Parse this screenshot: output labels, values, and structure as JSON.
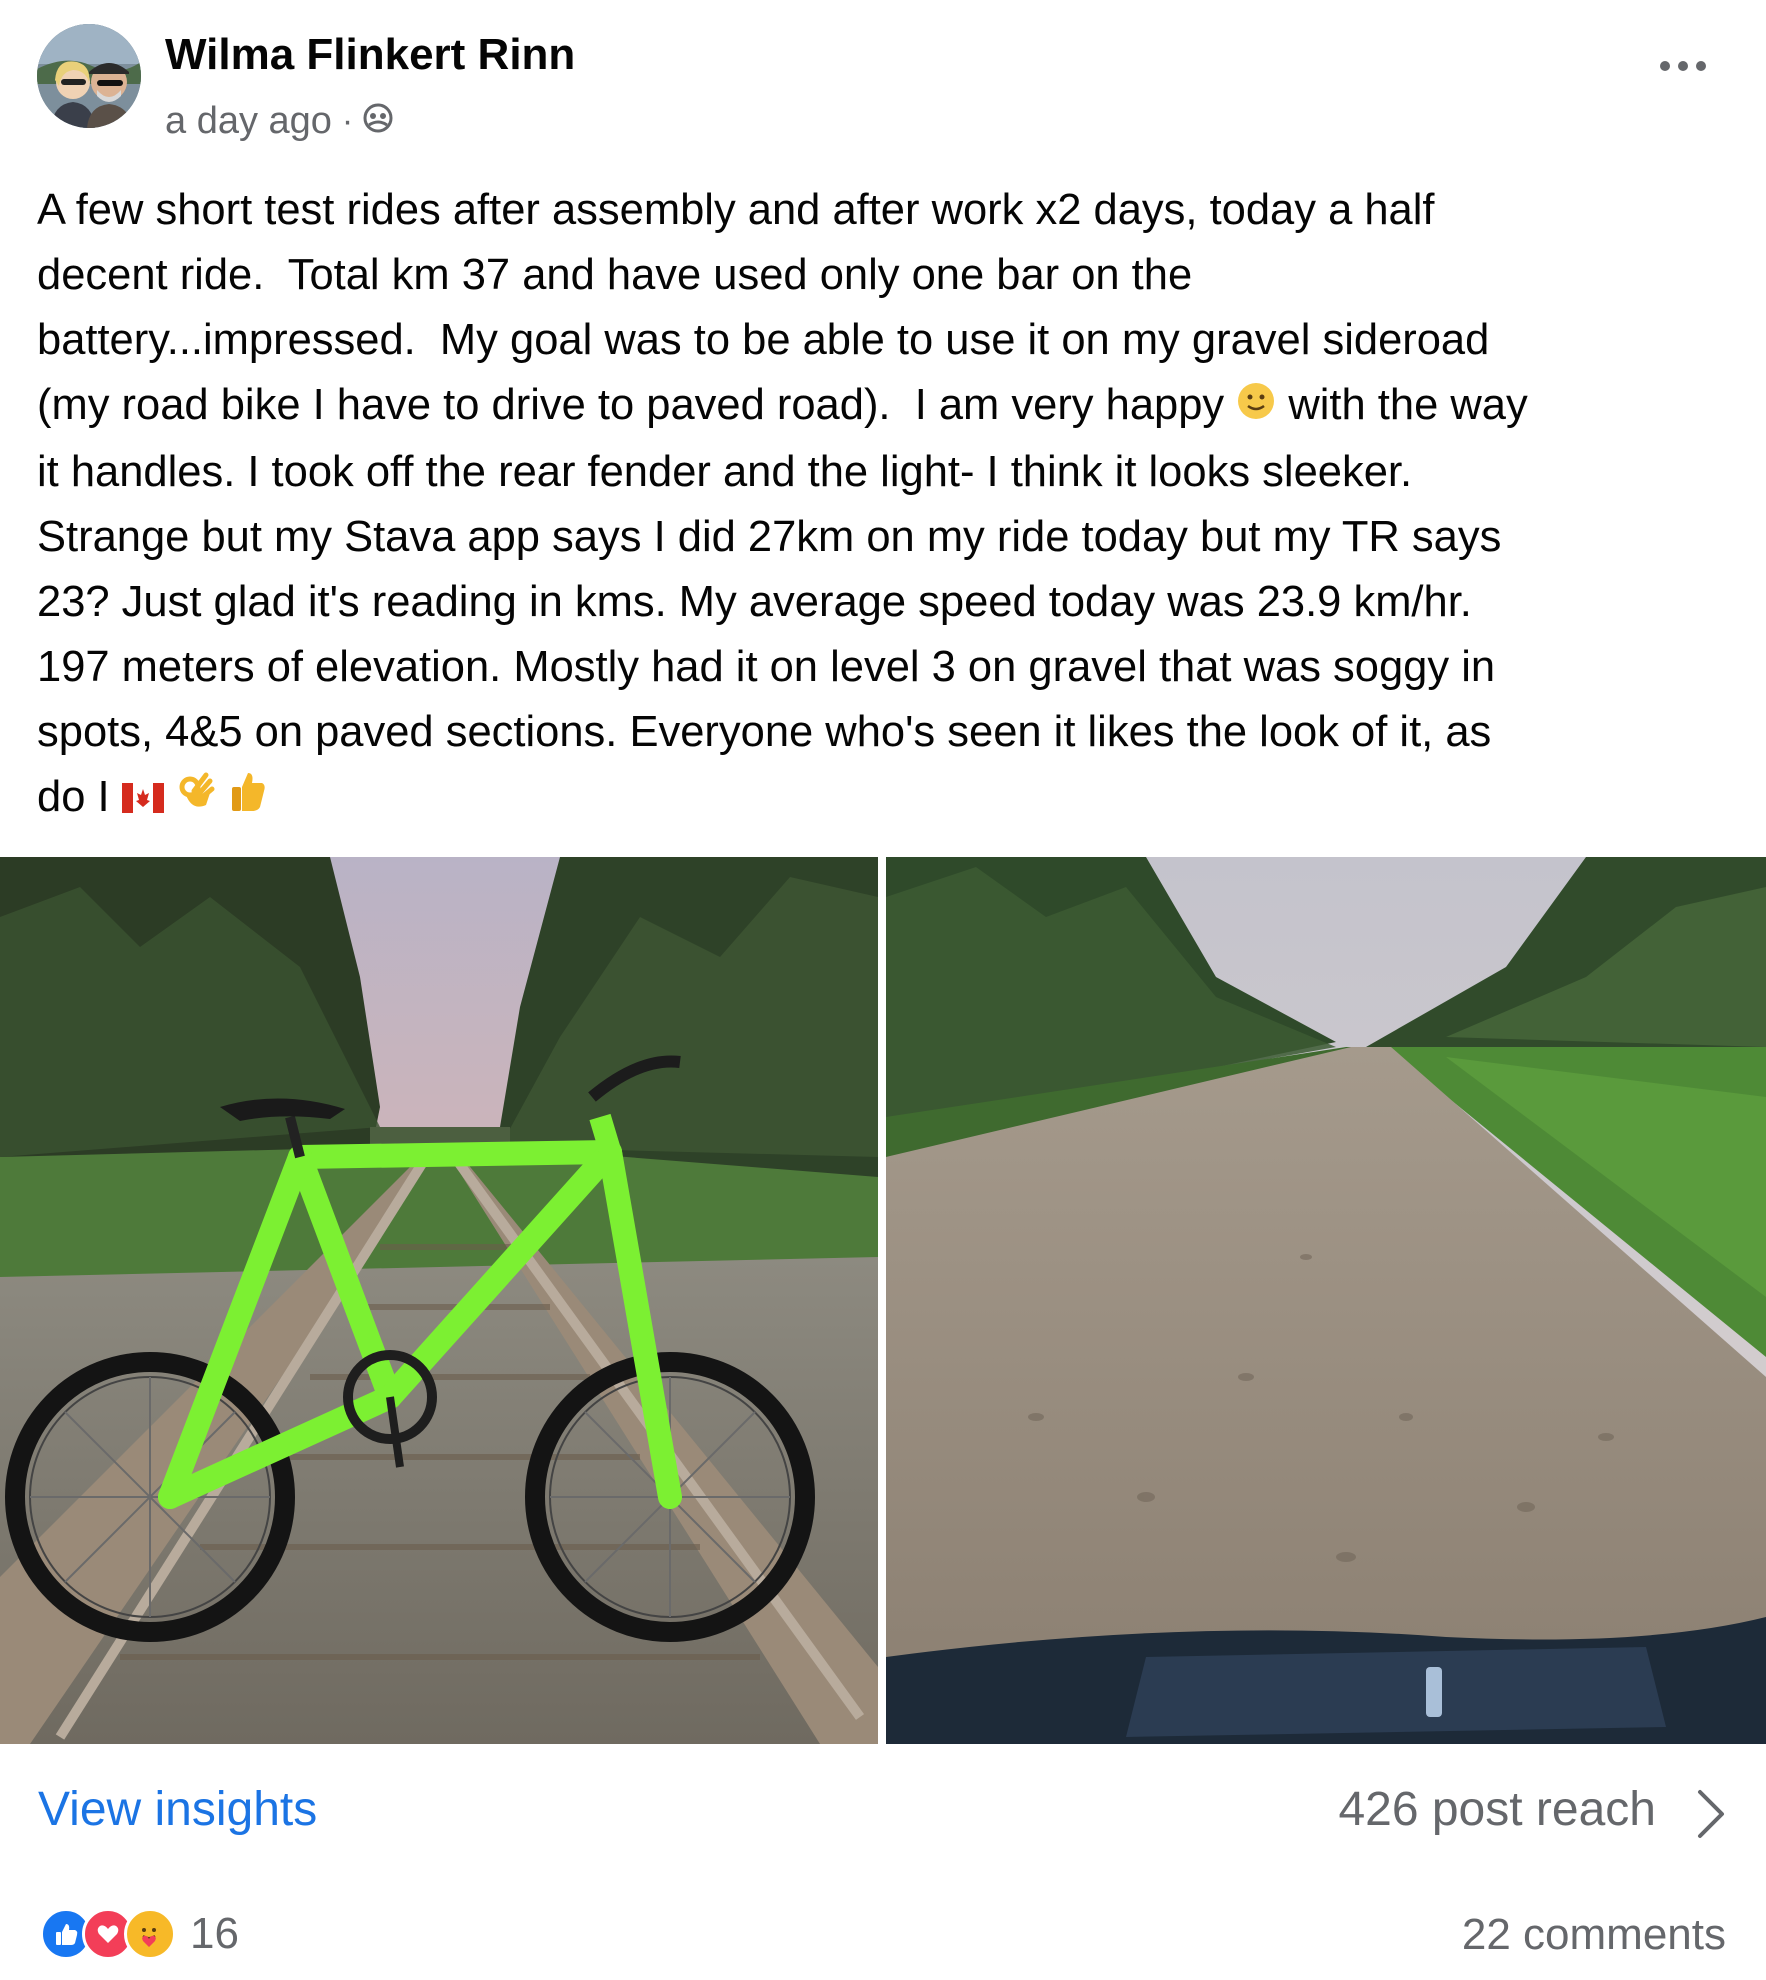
{
  "post": {
    "author": "Wilma Flinkert Rinn",
    "timestamp": "a day ago",
    "separator": "·",
    "audience_icon": "group-audience-icon",
    "menu_icon": "more-options-icon",
    "text_lines": [
      "A few short test rides after assembly and after work x2 days, today a half",
      "decent ride.  Total km 37 and have used only one bar on the",
      "battery...impressed.  My goal was to be able to use it on my gravel sideroad",
      "(my road bike I have to drive to paved road).  I am very happy",
      " with the way",
      "it handles. I took off the rear fender and the light- I think it looks sleeker.",
      "Strange but my Stava app says I did 27km on my ride today but my TR says",
      "23? Just glad it's reading in kms. My average speed today was 23.9 km/hr.",
      "197 meters of elevation. Mostly had it on level 3 on gravel that was soggy in",
      "spots, 4&5 on paved sections. Everyone who's seen it likes the look of it, as",
      "do I "
    ],
    "emojis": [
      "slightly-smiling-face",
      "canada-flag",
      "ok-hand",
      "thumbs-up"
    ],
    "photos": [
      {
        "name": "green-bike-on-railway-tracks-photo"
      },
      {
        "name": "gravel-road-photo"
      }
    ]
  },
  "insights": {
    "link_label": "View insights",
    "reach_label": "426 post reach",
    "chevron_icon": "chevron-right-icon"
  },
  "footer": {
    "reaction_icons": [
      "like",
      "love",
      "care"
    ],
    "reaction_count": "16",
    "comments_label": "22 comments"
  },
  "colors": {
    "link_blue": "#1b74e4",
    "secondary_text": "#65676b",
    "like_blue": "#1877f2",
    "love_red": "#f33e58",
    "care_yellow": "#f7b928"
  }
}
